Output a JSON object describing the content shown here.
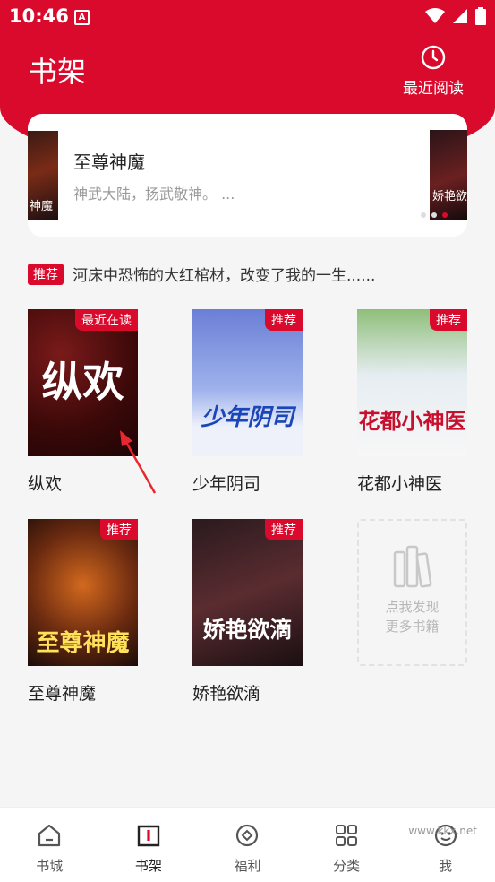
{
  "status_bar": {
    "time": "10:46",
    "app_icon_letter": "A"
  },
  "header": {
    "title": "书架",
    "recent_label": "最近阅读"
  },
  "banner": {
    "title": "至尊神魔",
    "description": "神武大陆，扬武敬神。 ...",
    "left_cover_text": "神魔",
    "right_cover_text": "娇艳欲",
    "dots": 3,
    "active_dot": 2
  },
  "recommend": {
    "badge": "推荐",
    "text": "河床中恐怖的大红棺材，改变了我的一生......"
  },
  "books": [
    {
      "name": "纵欢",
      "tag": "最近在读",
      "cover_text": "纵欢"
    },
    {
      "name": "少年阴司",
      "tag": "推荐",
      "cover_text": "少年阴司"
    },
    {
      "name": "花都小神医",
      "tag": "推荐",
      "cover_text": "花都小神医"
    },
    {
      "name": "至尊神魔",
      "tag": "推荐",
      "cover_text": "至尊神魔"
    },
    {
      "name": "娇艳欲滴",
      "tag": "推荐",
      "cover_text": "娇艳欲滴"
    }
  ],
  "discover": {
    "line1": "点我发现",
    "line2": "更多书籍"
  },
  "tabs": [
    {
      "label": "书城",
      "icon": "home-icon"
    },
    {
      "label": "书架",
      "icon": "bookshelf-icon",
      "active": true
    },
    {
      "label": "福利",
      "icon": "gift-icon"
    },
    {
      "label": "分类",
      "icon": "grid-icon"
    },
    {
      "label": "我",
      "icon": "profile-icon"
    }
  ],
  "colors": {
    "brand": "#d90a2c"
  },
  "watermark": "www.kkx.net"
}
